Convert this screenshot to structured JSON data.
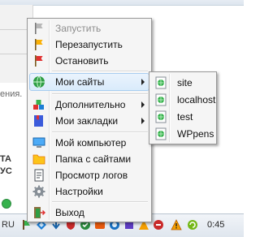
{
  "background": {
    "partial_text": "ения.",
    "bold_lines": [
      "ТА",
      "УС"
    ],
    "status": "success"
  },
  "menu": {
    "items": [
      {
        "label": "Запустить",
        "icon": "flag-gray-icon",
        "enabled": false
      },
      {
        "label": "Перезапустить",
        "icon": "flag-yellow-icon",
        "enabled": true
      },
      {
        "label": "Остановить",
        "icon": "flag-red-icon",
        "enabled": true
      },
      {
        "label": "Мои сайты",
        "icon": "globe-icon",
        "enabled": true,
        "submenu": true,
        "highlighted": true
      },
      {
        "label": "Дополнительно",
        "icon": "blocks-icon",
        "enabled": true,
        "submenu": true
      },
      {
        "label": "Мои закладки",
        "icon": "bookmarks-icon",
        "enabled": true,
        "submenu": true
      },
      {
        "label": "Мой компьютер",
        "icon": "computer-icon",
        "enabled": true
      },
      {
        "label": "Папка с сайтами",
        "icon": "folder-icon",
        "enabled": true
      },
      {
        "label": "Просмотр логов",
        "icon": "document-icon",
        "enabled": true
      },
      {
        "label": "Настройки",
        "icon": "gear-icon",
        "enabled": true
      },
      {
        "label": "Выход",
        "icon": "exit-icon",
        "enabled": true
      }
    ]
  },
  "submenu": {
    "items": [
      {
        "label": "site",
        "icon": "web-page-icon"
      },
      {
        "label": "localhost",
        "icon": "web-page-icon"
      },
      {
        "label": "test",
        "icon": "web-page-icon"
      },
      {
        "label": "WPpens",
        "icon": "web-page-icon"
      }
    ]
  },
  "taskbar": {
    "language": "RU",
    "clock": "0:45"
  },
  "colors": {
    "menu_bg": "#f5f5f5",
    "highlight_bg": "#d9ebfb",
    "highlight_border": "#a8cdf0",
    "disabled_text": "#8d8d8d"
  }
}
